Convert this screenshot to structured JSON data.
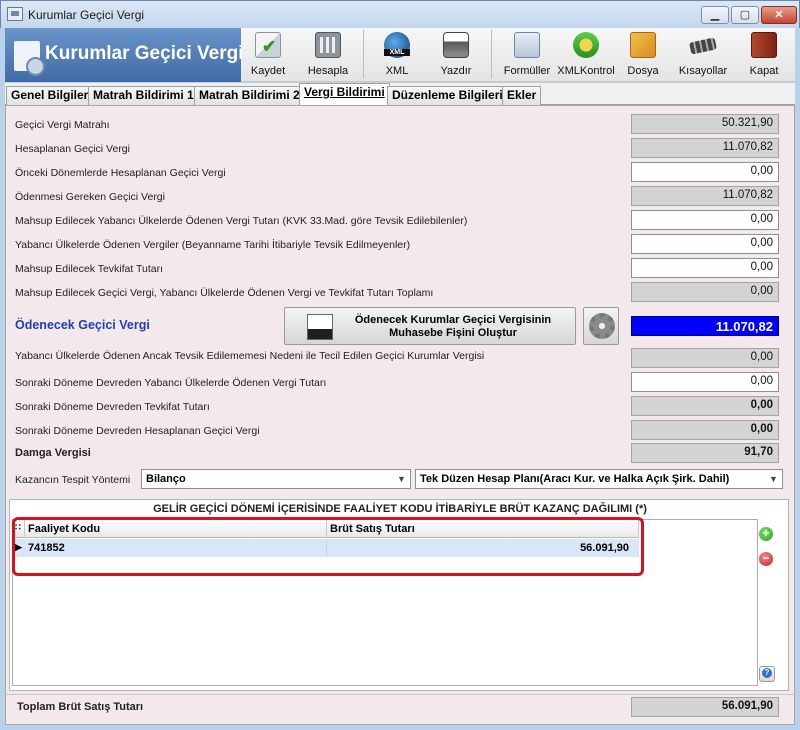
{
  "window": {
    "title": "Kurumlar Geçici Vergi",
    "minimize_glyph": "▁",
    "maximize_glyph": "▢",
    "close_glyph": "✕"
  },
  "header": {
    "banner_title": "Kurumlar Geçici Vergi",
    "toolbar": [
      {
        "label": "Kaydet",
        "icon": "save-check-icon"
      },
      {
        "label": "Hesapla",
        "icon": "calculator-icon"
      },
      {
        "label": "XML",
        "icon": "xml-globe-icon"
      },
      {
        "label": "Yazdır",
        "icon": "printer-icon"
      },
      {
        "label": "Formüller",
        "icon": "forms-icon"
      },
      {
        "label": "XMLKontrol",
        "icon": "xml-check-icon"
      },
      {
        "label": "Dosya",
        "icon": "folder-icon"
      },
      {
        "label": "Kısayollar",
        "icon": "keyboard-icon"
      },
      {
        "label": "Kapat",
        "icon": "exit-door-icon"
      }
    ]
  },
  "tabs": [
    "Genel Bilgiler",
    "Matrah Bildirimi 1",
    "Matrah Bildirimi 2",
    "Vergi Bildirimi",
    "Düzenleme Bilgileri",
    "Ekler"
  ],
  "active_tab": "Vergi Bildirimi",
  "fields": [
    {
      "label": "Geçici Vergi Matrahı",
      "value": "50.321,90"
    },
    {
      "label": "Hesaplanan Geçici Vergi",
      "value": "11.070,82"
    },
    {
      "label": "Önceki Dönemlerde Hesaplanan Geçici Vergi",
      "value": "0,00"
    },
    {
      "label": "Ödenmesi Gereken Geçici Vergi",
      "value": "11.070,82"
    },
    {
      "label": "Mahsup Edilecek Yabancı Ülkelerde Ödenen Vergi Tutarı (KVK 33.Mad. göre Tevsik Edilebilenler)",
      "value": "0,00"
    },
    {
      "label": "Yabancı Ülkelerde Ödenen Vergiler (Beyanname Tarihi İtibariyle Tevsik Edilmeyenler)",
      "value": "0,00"
    },
    {
      "label": "Mahsup Edilecek Tevkifat Tutarı",
      "value": "0,00"
    },
    {
      "label": "Mahsup Edilecek Geçici Vergi, Yabancı Ülkelerde Ödenen Vergi ve Tevkifat Tutarı Toplamı",
      "value": "0,00"
    }
  ],
  "odenecek": {
    "label": "Ödenecek Geçici Vergi",
    "button_label": "Ödenecek Kurumlar Geçici Vergisinin\nMuhasebe Fişini Oluştur",
    "value": "11.070,82"
  },
  "fields2": [
    {
      "label": "Yabancı Ülkelerde Ödenen Ancak Tevsik Edilememesi Nedeni ile Tecil Edilen Geçici Kurumlar Vergisi",
      "value": "0,00"
    },
    {
      "label": "Sonraki Döneme Devreden Yabancı Ülkelerde Ödenen Vergi Tutarı",
      "value": "0,00"
    },
    {
      "label": "Sonraki Döneme Devreden Tevkifat Tutarı",
      "value": "0,00"
    },
    {
      "label": "Sonraki Döneme Devreden Hesaplanan Geçici Vergi",
      "value": "0,00"
    },
    {
      "label": "Damga Vergisi",
      "value": "91,70"
    }
  ],
  "kazanc": {
    "label": "Kazancın Tespit Yöntemi",
    "method": "Bilanço",
    "plan": "Tek Düzen Hesap Planı(Aracı Kur. ve Halka Açık Şirk. Dahil)"
  },
  "faaliyet": {
    "title": "GELİR GEÇİCİ DÖNEMİ İÇERİSİNDE FAALİYET KODU İTİBARİYLE BRÜT KAZANÇ DAĞILIMI (*)",
    "columns": [
      "Faaliyet Kodu",
      "Brüt Satış Tutarı"
    ],
    "rows": [
      {
        "code": "741852",
        "amount": "56.091,90"
      }
    ]
  },
  "footer": {
    "label": "Toplam Brüt Satış Tutarı",
    "value": "56.091,90"
  }
}
